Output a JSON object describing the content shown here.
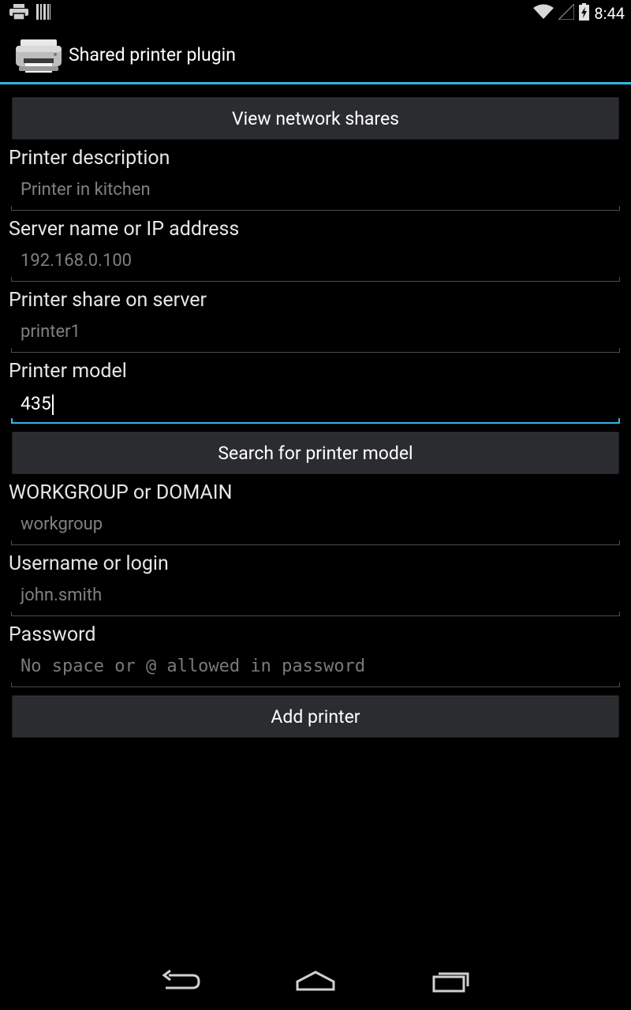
{
  "status_bar": {
    "time": "8:44",
    "left_icons": [
      "printer-notification-icon",
      "barcode-notification-icon"
    ],
    "right_icons": [
      "wifi-icon",
      "signal-icon",
      "battery-charging-icon"
    ]
  },
  "app": {
    "title": "Shared printer plugin",
    "icon": "printer-app-icon",
    "accent_color": "#33b5e5"
  },
  "buttons": {
    "view_shares": "View network shares",
    "search_model": "Search for printer model",
    "add_printer": "Add printer"
  },
  "fields": {
    "description": {
      "label": "Printer description",
      "placeholder": "Printer in kitchen",
      "value": ""
    },
    "server": {
      "label": "Server name or IP address",
      "placeholder": "192.168.0.100",
      "value": ""
    },
    "share": {
      "label": "Printer share on server",
      "placeholder": "printer1",
      "value": ""
    },
    "model": {
      "label": "Printer model",
      "placeholder": "",
      "value": "435"
    },
    "workgroup": {
      "label": "WORKGROUP or DOMAIN",
      "placeholder": "workgroup",
      "value": ""
    },
    "username": {
      "label": "Username or login",
      "placeholder": "john.smith",
      "value": ""
    },
    "password": {
      "label": "Password",
      "placeholder": "No space or @ allowed in password",
      "value": ""
    }
  },
  "nav_bar": {
    "items": [
      "back-icon",
      "home-icon",
      "recent-apps-icon"
    ]
  }
}
